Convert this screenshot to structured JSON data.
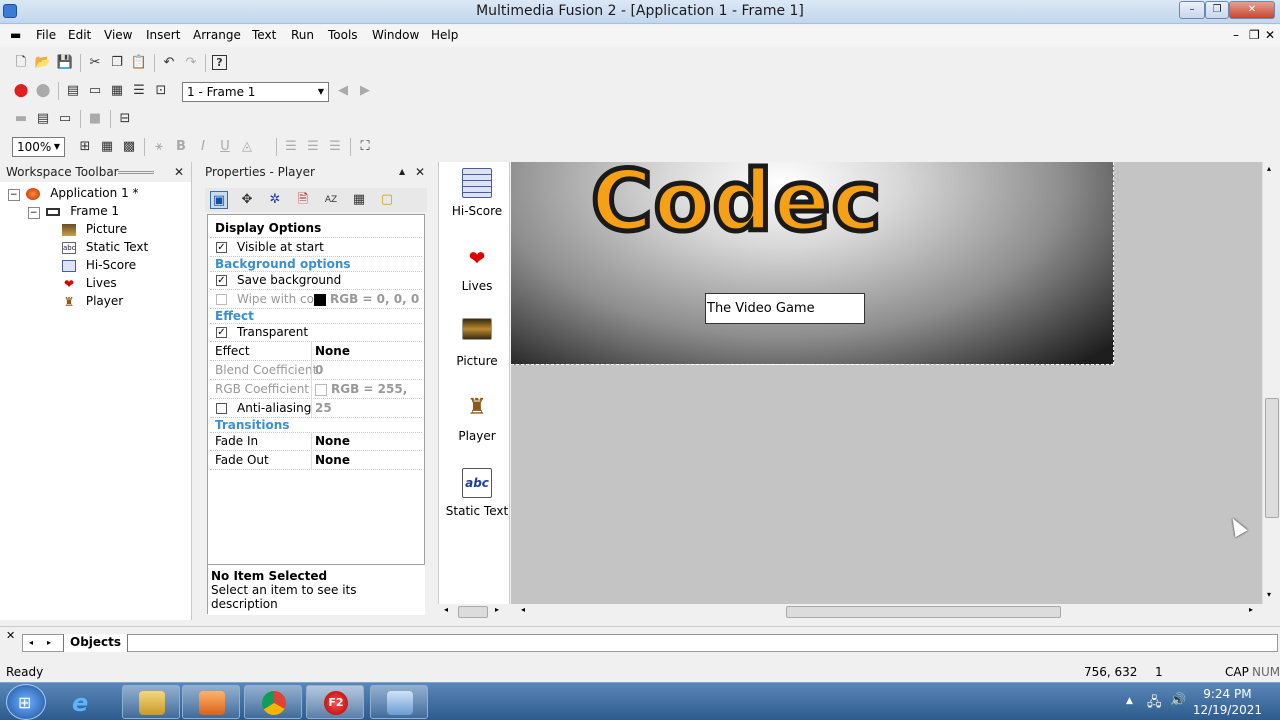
{
  "window": {
    "title": "Multimedia Fusion 2 - [Application 1 - Frame 1]",
    "min": "–",
    "max": "❐",
    "close": "✕",
    "doc_min": "–",
    "doc_restore": "❐",
    "doc_close": "✕"
  },
  "menu": [
    "File",
    "Edit",
    "View",
    "Insert",
    "Arrange",
    "Text",
    "Run",
    "Tools",
    "Window",
    "Help"
  ],
  "toolbar": {
    "frame_select": "1 - Frame 1",
    "zoom": "100%"
  },
  "workspace": {
    "title": "Workspace Toolbar",
    "close": "✕",
    "tree": {
      "app": "Application 1 *",
      "frame": "Frame 1",
      "objects": [
        "Picture",
        "Static Text",
        "Hi-Score",
        "Lives",
        "Player"
      ]
    }
  },
  "properties": {
    "title": "Properties - Player",
    "close": "✕",
    "rows": {
      "display_options": "Display Options",
      "visible": "Visible at start",
      "bg_options": "Background options",
      "save_bg": "Save background",
      "wipe": "Wipe with co",
      "wipe_val": "RGB = 0, 0, 0",
      "effect_sec": "Effect",
      "transparent": "Transparent",
      "effect": "Effect",
      "effect_val": "None",
      "blend": "Blend Coefficient",
      "blend_val": "0",
      "rgb": "RGB Coefficient",
      "rgb_val": "RGB = 255, 25",
      "antialias": "Anti-aliasing",
      "transitions": "Transitions",
      "fade_in": "Fade In",
      "fade_in_val": "None",
      "fade_out": "Fade Out",
      "fade_out_val": "None"
    },
    "desc_title": "No Item Selected",
    "desc_text": "Select an item to see its description"
  },
  "library": [
    "Hi-Score",
    "Lives",
    "Picture",
    "Player",
    "Static Text"
  ],
  "frame": {
    "logo": "Codec",
    "subtitle": "The Video Game"
  },
  "bottom_tab": "Objects",
  "status": {
    "left": "Ready",
    "coords": "756, 632",
    "layer": "1",
    "cap": "CAP",
    "num": "NUM"
  },
  "taskbar": {
    "time": "9:24 PM",
    "date": "12/19/2021",
    "f2_label": "F2"
  }
}
